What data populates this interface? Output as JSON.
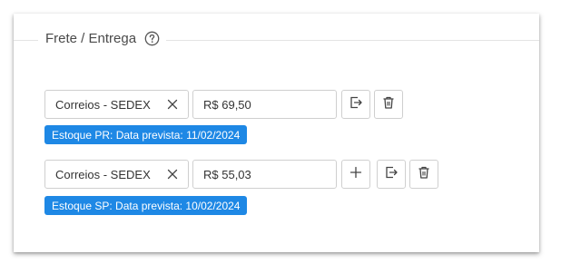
{
  "section": {
    "title": "Frete / Entrega",
    "help_icon": "help-circle-icon"
  },
  "shipping_options": [
    {
      "carrier": "Correios - SEDEX",
      "price": "R$ 69,50",
      "badge": "Estoque PR: Data prevista: 11/02/2024"
    },
    {
      "carrier": "Correios - SEDEX",
      "price": "R$ 55,03",
      "badge": "Estoque SP: Data prevista: 10/02/2024"
    }
  ],
  "colors": {
    "badge_bg": "#1e88e5",
    "border": "#cfcfcf",
    "text": "#333333"
  }
}
